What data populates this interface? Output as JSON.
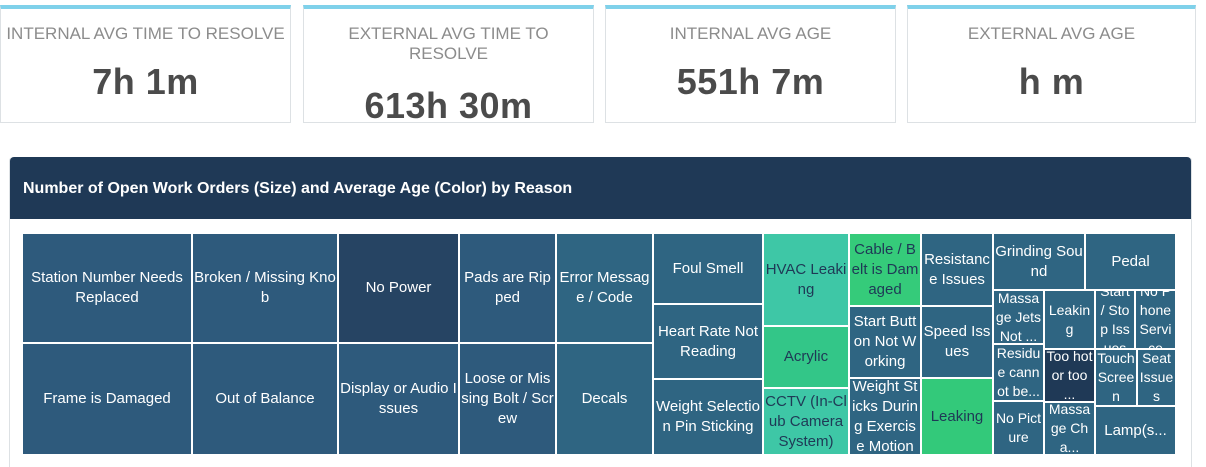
{
  "kpis": [
    {
      "label": "INTERNAL AVG TIME TO RESOLVE",
      "value": "7h 1m"
    },
    {
      "label": "EXTERNAL AVG TIME TO RESOLVE",
      "value": "613h 30m"
    },
    {
      "label": "INTERNAL AVG AGE",
      "value": "551h 7m"
    },
    {
      "label": "EXTERNAL AVG AGE",
      "value": "h m"
    }
  ],
  "panel": {
    "title": "Number of Open Work Orders (Size) and Average Age (Color) by Reason"
  },
  "colors": {
    "header": "#1f3956",
    "kpi_accent": "#7fd1ea",
    "tile_navy": "#274765",
    "tile_blue": "#2e5c7e",
    "tile_teal": "#2d6a85",
    "tile_cyan": "#3ec5a5",
    "tile_green": "#3ecf7d"
  },
  "treemap": {
    "tiles": [
      {
        "label": "Station Number Needs Replaced",
        "color": "#2e5a7c"
      },
      {
        "label": "Frame is Damaged",
        "color": "#2e5a7c"
      },
      {
        "label": "Broken / Missing Knob",
        "color": "#2e5a7c"
      },
      {
        "label": "Out of Balance",
        "color": "#2e5a7c"
      },
      {
        "label": "No Power",
        "color": "#264463"
      },
      {
        "label": "Display or Audio Issues",
        "color": "#2e5a7c"
      },
      {
        "label": "Pads are Ripped",
        "color": "#2e5a7c"
      },
      {
        "label": "Loose or Missing Bolt / Screw",
        "color": "#2e5a7c"
      },
      {
        "label": "Error Message / Code",
        "color": "#2f6582"
      },
      {
        "label": "Decals",
        "color": "#2f6582"
      },
      {
        "label": "Foul Smell",
        "color": "#2f6582"
      },
      {
        "label": "Heart Rate Not Reading",
        "color": "#2f6582"
      },
      {
        "label": "Weight Selection Pin Sticking",
        "color": "#2f6582"
      },
      {
        "label": "HVAC Leaking",
        "color": "#3ec7a6"
      },
      {
        "label": "Acrylic",
        "color": "#33c688"
      },
      {
        "label": "CCTV (In-Club Camera System)",
        "color": "#3ec7a6"
      },
      {
        "label": "Cable / Belt is Damaged",
        "color": "#35cb7a"
      },
      {
        "label": "Start Button Not Working",
        "color": "#2f6582"
      },
      {
        "label": "Weight Sticks During Exercise Motion",
        "color": "#2f6582"
      },
      {
        "label": "Resistance Issues",
        "color": "#2f6582"
      },
      {
        "label": "Speed Issues",
        "color": "#2f6582"
      },
      {
        "label": "Leaking",
        "color": "#33c97a"
      },
      {
        "label": "Grinding Sound",
        "color": "#2f6582"
      },
      {
        "label": "Pedal",
        "color": "#2f6582"
      },
      {
        "label": "Massage Jets Not ...",
        "color": "#2f6582"
      },
      {
        "label": "Leaking",
        "color": "#2f6582"
      },
      {
        "label": "Start / Stop Issues",
        "color": "#2f6582"
      },
      {
        "label": "No Phone Service",
        "color": "#2f6582"
      },
      {
        "label": "Residue cannot be...",
        "color": "#2f6582"
      },
      {
        "label": "Too hot or too ...",
        "color": "#1f3956"
      },
      {
        "label": "Touch Screen",
        "color": "#2f6582"
      },
      {
        "label": "Seat Issues",
        "color": "#2f6582"
      },
      {
        "label": "No Picture",
        "color": "#2f6582"
      },
      {
        "label": "Massage Cha...",
        "color": "#2f6582"
      },
      {
        "label": "Lamp(s...",
        "color": "#2f6582"
      }
    ]
  }
}
